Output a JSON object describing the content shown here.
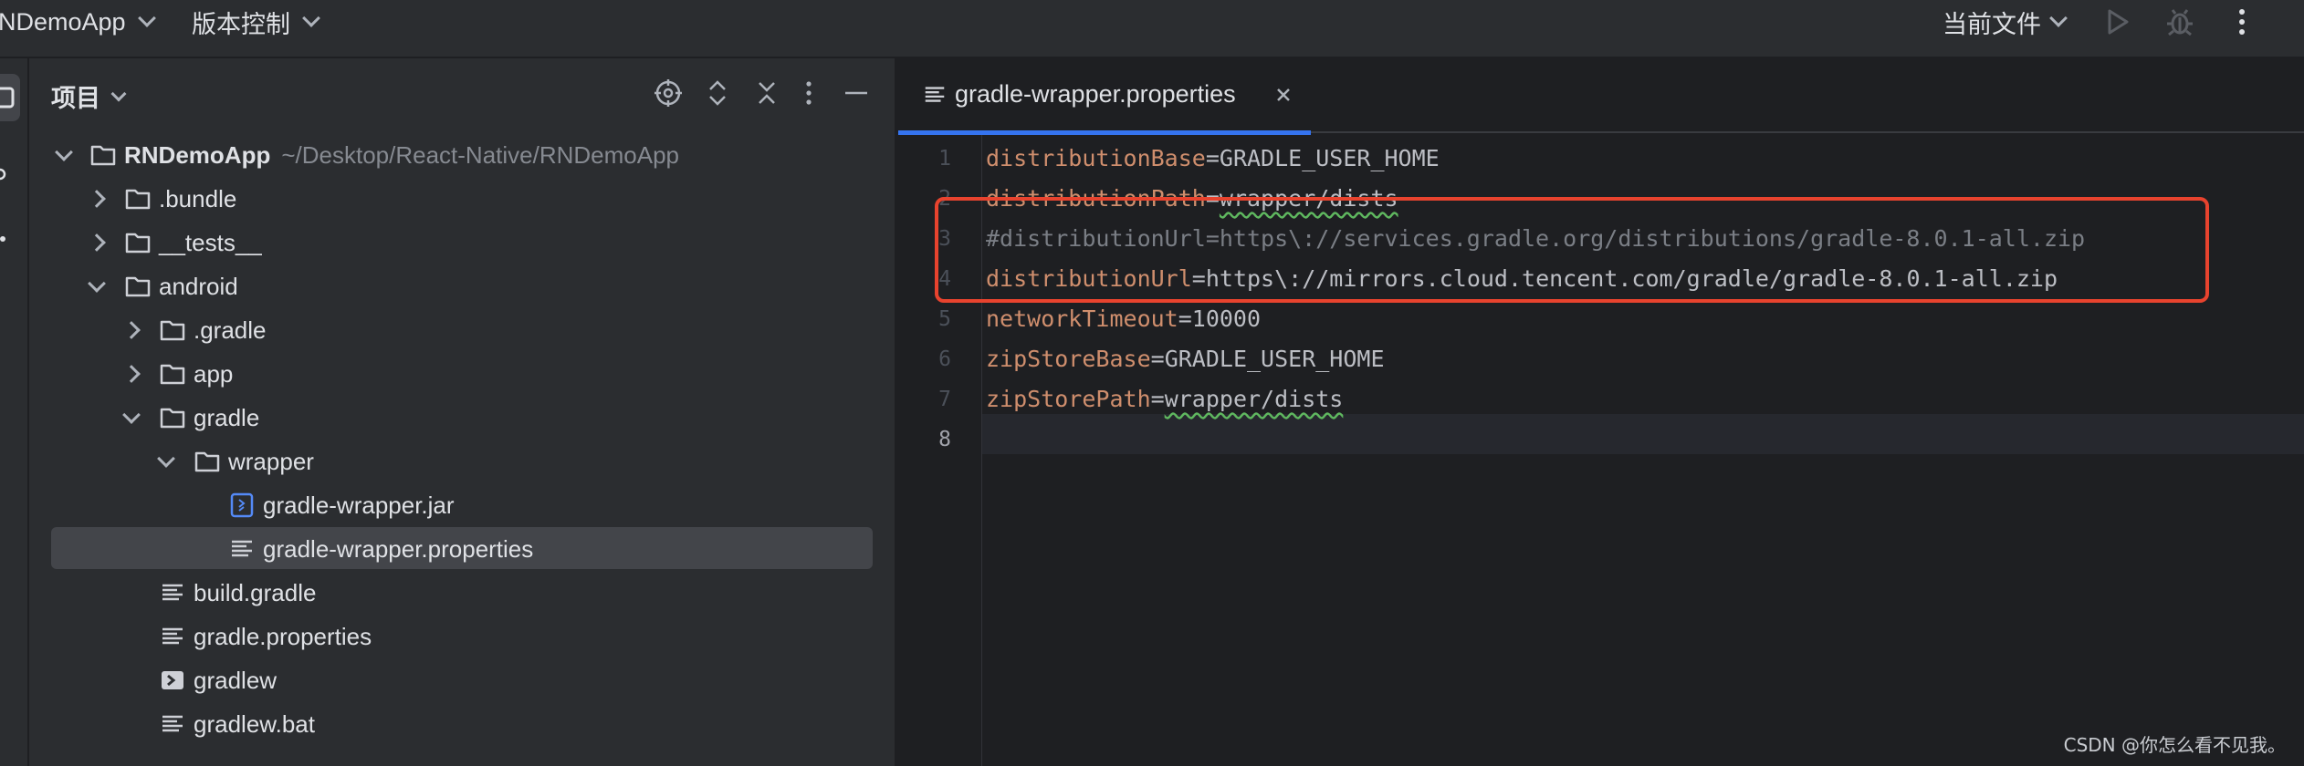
{
  "titlebar": {
    "project_name": "NDemoApp",
    "vcs_label": "版本控制",
    "run_config": "当前文件"
  },
  "project_panel": {
    "title": "项目",
    "tree": [
      {
        "label": "RNDemoApp",
        "path": "~/Desktop/React-Native/RNDemoApp",
        "type": "folder",
        "expanded": true,
        "level": 0
      },
      {
        "label": ".bundle",
        "type": "folder",
        "expanded": false,
        "level": 1
      },
      {
        "label": "__tests__",
        "type": "folder",
        "expanded": false,
        "level": 1
      },
      {
        "label": "android",
        "type": "folder",
        "expanded": true,
        "level": 1
      },
      {
        "label": ".gradle",
        "type": "folder",
        "expanded": false,
        "level": 2
      },
      {
        "label": "app",
        "type": "folder",
        "expanded": false,
        "level": 2
      },
      {
        "label": "gradle",
        "type": "folder",
        "expanded": true,
        "level": 2
      },
      {
        "label": "wrapper",
        "type": "folder",
        "expanded": true,
        "level": 3
      },
      {
        "label": "gradle-wrapper.jar",
        "type": "jar",
        "level": 4
      },
      {
        "label": "gradle-wrapper.properties",
        "type": "text",
        "level": 4,
        "selected": true
      },
      {
        "label": "build.gradle",
        "type": "text",
        "level": 2
      },
      {
        "label": "gradle.properties",
        "type": "text",
        "level": 2
      },
      {
        "label": "gradlew",
        "type": "exec",
        "level": 2
      },
      {
        "label": "gradlew.bat",
        "type": "text",
        "level": 2
      }
    ]
  },
  "editor": {
    "active_tab": "gradle-wrapper.properties",
    "current_line": 8,
    "lines": [
      {
        "num": "1",
        "key": "distributionBase",
        "value": "GRADLE_USER_HOME"
      },
      {
        "num": "2",
        "key": "distributionPath",
        "value": "wrapper/dists"
      },
      {
        "num": "3",
        "comment": "#distributionUrl=https\\://services.gradle.org/distributions/gradle-8.0.1-all.zip"
      },
      {
        "num": "4",
        "key": "distributionUrl",
        "value": "https\\://mirrors.cloud.tencent.com/gradle/gradle-8.0.1-all.zip"
      },
      {
        "num": "5",
        "key": "networkTimeout",
        "value": "10000"
      },
      {
        "num": "6",
        "key": "zipStoreBase",
        "value": "GRADLE_USER_HOME"
      },
      {
        "num": "7",
        "key": "zipStorePath",
        "value": "wrapper/dists"
      },
      {
        "num": "8"
      }
    ]
  },
  "watermark": "CSDN @你怎么看不见我。",
  "colors": {
    "background": "#1e1f22",
    "panel": "#2b2d30",
    "selection": "#43454a",
    "accent": "#3574f0",
    "property_key": "#cf8e6d",
    "annotation_box": "#e8432e"
  },
  "icons": [
    "chevron-down-icon",
    "run-icon",
    "debug-icon",
    "more-vertical-icon",
    "locate-icon",
    "expand-collapse-icon",
    "close-icon",
    "minimize-icon",
    "folder-icon",
    "jar-file-icon",
    "text-file-icon",
    "executable-file-icon"
  ]
}
